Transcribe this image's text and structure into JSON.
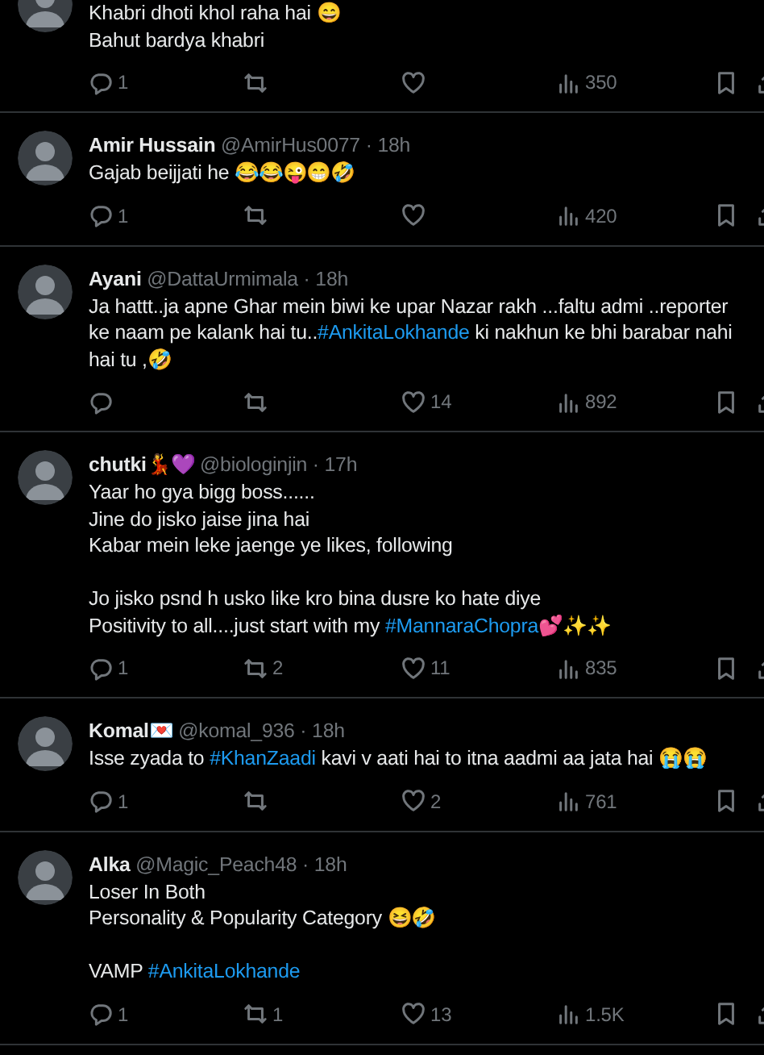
{
  "tweets": [
    {
      "body": [
        [
          [
            {
              "kind": "text",
              "text": "Khabri dhoti khol raha hai 😄"
            }
          ],
          [
            {
              "kind": "text",
              "text": "Bahut bardya khabri"
            }
          ]
        ]
      ],
      "actions": {
        "replies": "1",
        "views": "350"
      }
    },
    {
      "name": "Amir Hussain",
      "handle": "@AmirHus0077",
      "separator": "·",
      "time": "18h",
      "body": [
        [
          [
            {
              "kind": "text",
              "text": "Gajab beijjati he 😂😂😜😁🤣"
            }
          ]
        ]
      ],
      "actions": {
        "replies": "1",
        "views": "420"
      }
    },
    {
      "name": "Ayani",
      "handle": "@DattaUrmimala",
      "separator": "·",
      "time": "18h",
      "body": [
        [
          [
            {
              "kind": "text",
              "text": "Ja hattt..ja apne Ghar mein biwi ke upar Nazar rakh ...faltu admi ..reporter"
            }
          ],
          [
            {
              "kind": "text",
              "text": "ke naam pe kalank hai tu.."
            },
            {
              "kind": "hashtag",
              "text": "#AnkitaLokhande"
            },
            {
              "kind": "text",
              "text": " ki nakhun ke bhi barabar nahi"
            }
          ],
          [
            {
              "kind": "text",
              "text": "hai tu ,🤣"
            }
          ]
        ]
      ],
      "actions": {
        "likes": "14",
        "views": "892"
      }
    },
    {
      "name": "chutki💃💜",
      "handle": "@biologinjin",
      "separator": "·",
      "time": "17h",
      "body": [
        [
          [
            {
              "kind": "text",
              "text": "Yaar ho gya bigg boss......"
            }
          ],
          [
            {
              "kind": "text",
              "text": "Jine do jisko jaise jina hai"
            }
          ],
          [
            {
              "kind": "text",
              "text": "Kabar mein leke jaenge ye likes, following"
            }
          ]
        ],
        [
          [
            {
              "kind": "text",
              "text": "Jo jisko psnd h usko like kro bina dusre ko hate diye"
            }
          ],
          [
            {
              "kind": "text",
              "text": "Positivity to all....just start with my "
            },
            {
              "kind": "hashtag",
              "text": "#MannaraChopra"
            },
            {
              "kind": "text",
              "text": "💕✨✨"
            }
          ]
        ]
      ],
      "actions": {
        "replies": "1",
        "reposts": "2",
        "likes": "11",
        "views": "835"
      }
    },
    {
      "name": "Komal💌",
      "handle": "@komal_936",
      "separator": "·",
      "time": "18h",
      "body": [
        [
          [
            {
              "kind": "text",
              "text": "Isse zyada to "
            },
            {
              "kind": "hashtag",
              "text": "#KhanZaadi"
            },
            {
              "kind": "text",
              "text": " kavi v aati hai to itna aadmi aa jata hai 😭😭"
            }
          ]
        ]
      ],
      "actions": {
        "replies": "1",
        "likes": "2",
        "views": "761"
      }
    },
    {
      "name": "Alka",
      "handle": "@Magic_Peach48",
      "separator": "·",
      "time": "18h",
      "body": [
        [
          [
            {
              "kind": "text",
              "text": "Loser In Both"
            }
          ],
          [
            {
              "kind": "text",
              "text": "Personality & Popularity Category 😆🤣"
            }
          ]
        ],
        [
          [
            {
              "kind": "text",
              "text": "VAMP "
            },
            {
              "kind": "hashtag",
              "text": "#AnkitaLokhande"
            }
          ]
        ]
      ],
      "actions": {
        "replies": "1",
        "reposts": "1",
        "likes": "13",
        "views": "1.5K"
      }
    }
  ]
}
